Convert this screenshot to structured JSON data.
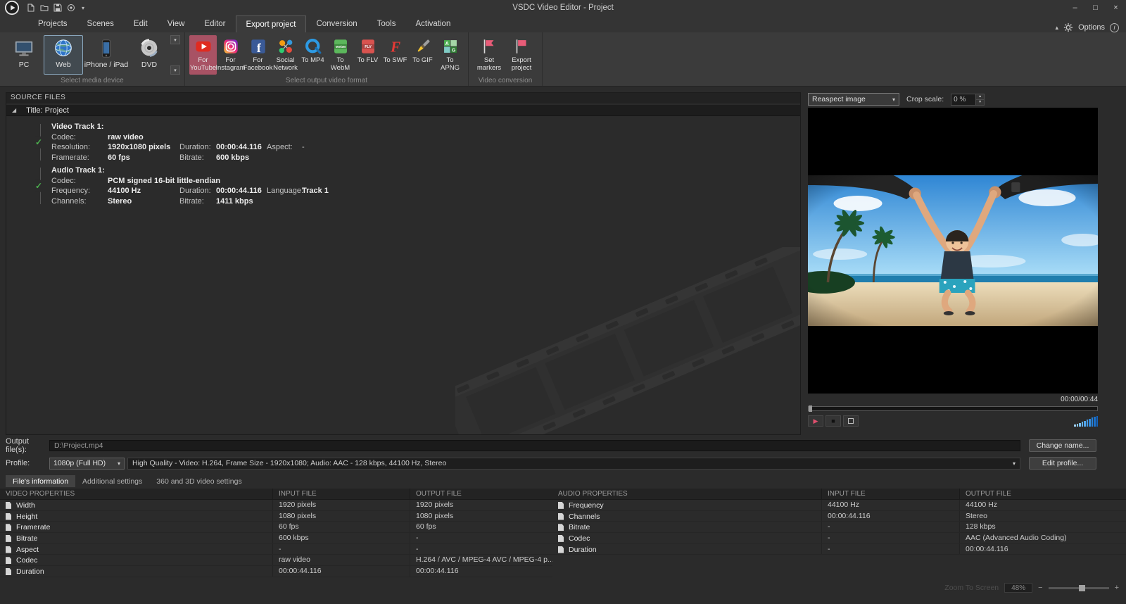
{
  "titlebar": {
    "title": "VSDC Video Editor - Project"
  },
  "menubar": {
    "tabs": [
      "Projects",
      "Scenes",
      "Edit",
      "View",
      "Editor",
      "Export project",
      "Conversion",
      "Tools",
      "Activation"
    ],
    "options_label": "Options"
  },
  "ribbon": {
    "devices": {
      "caption": "Select media device",
      "items": [
        "PC",
        "Web",
        "iPhone / iPad",
        "DVD"
      ]
    },
    "formats": {
      "caption": "Select output video format",
      "items": [
        "For YouTube",
        "For Instagram",
        "For Facebook",
        "Social Network",
        "To MP4",
        "To WebM",
        "To FLV",
        "To SWF",
        "To GIF",
        "To APNG"
      ]
    },
    "conversion": {
      "caption": "Video conversion",
      "items": [
        "Set markers",
        "Export project"
      ]
    }
  },
  "source_panel": {
    "header": "SOURCE FILES",
    "project": "Title: Project",
    "video_track": {
      "title": "Video Track 1:",
      "codec_label": "Codec:",
      "codec": "raw video",
      "resolution_label": "Resolution:",
      "resolution": "1920x1080 pixels",
      "duration_label": "Duration:",
      "duration": "00:00:44.116",
      "aspect_label": "Aspect:",
      "aspect": "-",
      "framerate_label": "Framerate:",
      "framerate": "60 fps",
      "bitrate_label": "Bitrate:",
      "bitrate": "600 kbps"
    },
    "audio_track": {
      "title": "Audio Track 1:",
      "codec_label": "Codec:",
      "codec": "PCM signed 16-bit little-endian",
      "frequency_label": "Frequency:",
      "frequency": "44100 Hz",
      "duration_label": "Duration:",
      "duration": "00:00:44.116",
      "language_label": "Language:",
      "language": "Track 1",
      "channels_label": "Channels:",
      "channels": "Stereo",
      "bitrate_label": "Bitrate:",
      "bitrate": "1411 kbps"
    }
  },
  "preview": {
    "reaspect_value": "Reaspect image",
    "crop_scale_label": "Crop scale:",
    "crop_scale_value": "0 %",
    "timecode": "00:00/00:44"
  },
  "output_section": {
    "output_label": "Output file(s):",
    "output_path": "D:\\Project.mp4",
    "change_name_button": "Change name...",
    "profile_label": "Profile:",
    "profile_value": "1080p (Full HD)",
    "profile_description": "High Quality - Video: H.264, Frame Size - 1920x1080; Audio: AAC - 128 kbps, 44100 Hz, Stereo",
    "edit_profile_button": "Edit profile..."
  },
  "info_tabs": {
    "tabs": [
      "File's information",
      "Additional settings",
      "360 and 3D video settings"
    ],
    "active": "File's information"
  },
  "tables": {
    "video": {
      "headers": [
        "VIDEO PROPERTIES",
        "INPUT FILE",
        "OUTPUT FILE"
      ],
      "rows": [
        {
          "property": "Width",
          "input": "1920 pixels",
          "output": "1920 pixels"
        },
        {
          "property": "Height",
          "input": "1080 pixels",
          "output": "1080 pixels"
        },
        {
          "property": "Framerate",
          "input": "60 fps",
          "output": "60 fps"
        },
        {
          "property": "Bitrate",
          "input": "600 kbps",
          "output": "-"
        },
        {
          "property": "Aspect",
          "input": "-",
          "output": "-"
        },
        {
          "property": "Codec",
          "input": "raw video",
          "output": "H.264 / AVC / MPEG-4 AVC / MPEG-4 p..."
        },
        {
          "property": "Duration",
          "input": "00:00:44.116",
          "output": "00:00:44.116"
        }
      ]
    },
    "audio": {
      "headers": [
        "AUDIO PROPERTIES",
        "INPUT FILE",
        "OUTPUT FILE"
      ],
      "rows": [
        {
          "property": "Frequency",
          "input": "44100 Hz",
          "output": "44100 Hz"
        },
        {
          "property": "Channels",
          "input": "00:00:44.116",
          "output": "Stereo"
        },
        {
          "property": "Bitrate",
          "input": "-",
          "output": "128 kbps"
        },
        {
          "property": "Codec",
          "input": "-",
          "output": "AAC (Advanced Audio Coding)"
        },
        {
          "property": "Duration",
          "input": "-",
          "output": "00:00:44.116"
        }
      ]
    }
  },
  "statusbar": {
    "zoom_label": "Zoom To Screen",
    "zoom_value": "48%",
    "zoom_minus": "−",
    "zoom_plus": "+"
  },
  "icons": {
    "dropdown": "▾",
    "spin_up": "▴",
    "spin_down": "▾",
    "check": "✓",
    "collapse": "◢",
    "play": "▶",
    "stop": "■",
    "minimize": "–",
    "maximize": "□",
    "close": "×",
    "pin": "▴",
    "info": "i"
  },
  "colors": {
    "accent_pink": "#e85c78",
    "meter_blue": "#2a95e8",
    "check_green": "#4cb04f"
  }
}
